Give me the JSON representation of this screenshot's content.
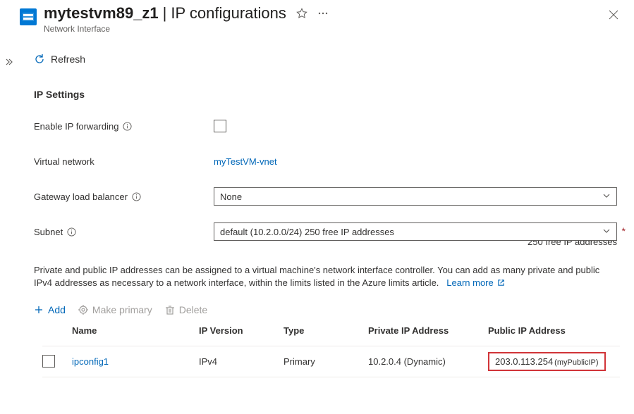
{
  "header": {
    "resource_name": "mytestvm89_z1",
    "page_title": "IP configurations",
    "subtitle": "Network Interface"
  },
  "toolbar": {
    "refresh_label": "Refresh"
  },
  "section": {
    "title": "IP Settings",
    "enable_ip_forwarding_label": "Enable IP forwarding",
    "virtual_network_label": "Virtual network",
    "virtual_network_value": "myTestVM-vnet",
    "gateway_lb_label": "Gateway load balancer",
    "gateway_lb_value": "None",
    "subnet_label": "Subnet",
    "subnet_value": "default (10.2.0.0/24) 250 free IP addresses",
    "subnet_helper": "250 free IP addresses"
  },
  "info": {
    "text": "Private and public IP addresses can be assigned to a virtual machine's network interface controller. You can add as many private and public IPv4 addresses as necessary to a network interface, within the limits listed in the Azure limits article.",
    "learn_more": "Learn more"
  },
  "actions": {
    "add": "Add",
    "make_primary": "Make primary",
    "delete": "Delete"
  },
  "grid": {
    "headers": {
      "name": "Name",
      "ip_version": "IP Version",
      "type": "Type",
      "private_ip": "Private IP Address",
      "public_ip": "Public IP Address"
    },
    "rows": [
      {
        "name": "ipconfig1",
        "ip_version": "IPv4",
        "type": "Primary",
        "private_ip": "10.2.0.4 (Dynamic)",
        "public_ip": "203.0.113.254",
        "public_ip_name": "(myPublicIP)"
      }
    ]
  }
}
